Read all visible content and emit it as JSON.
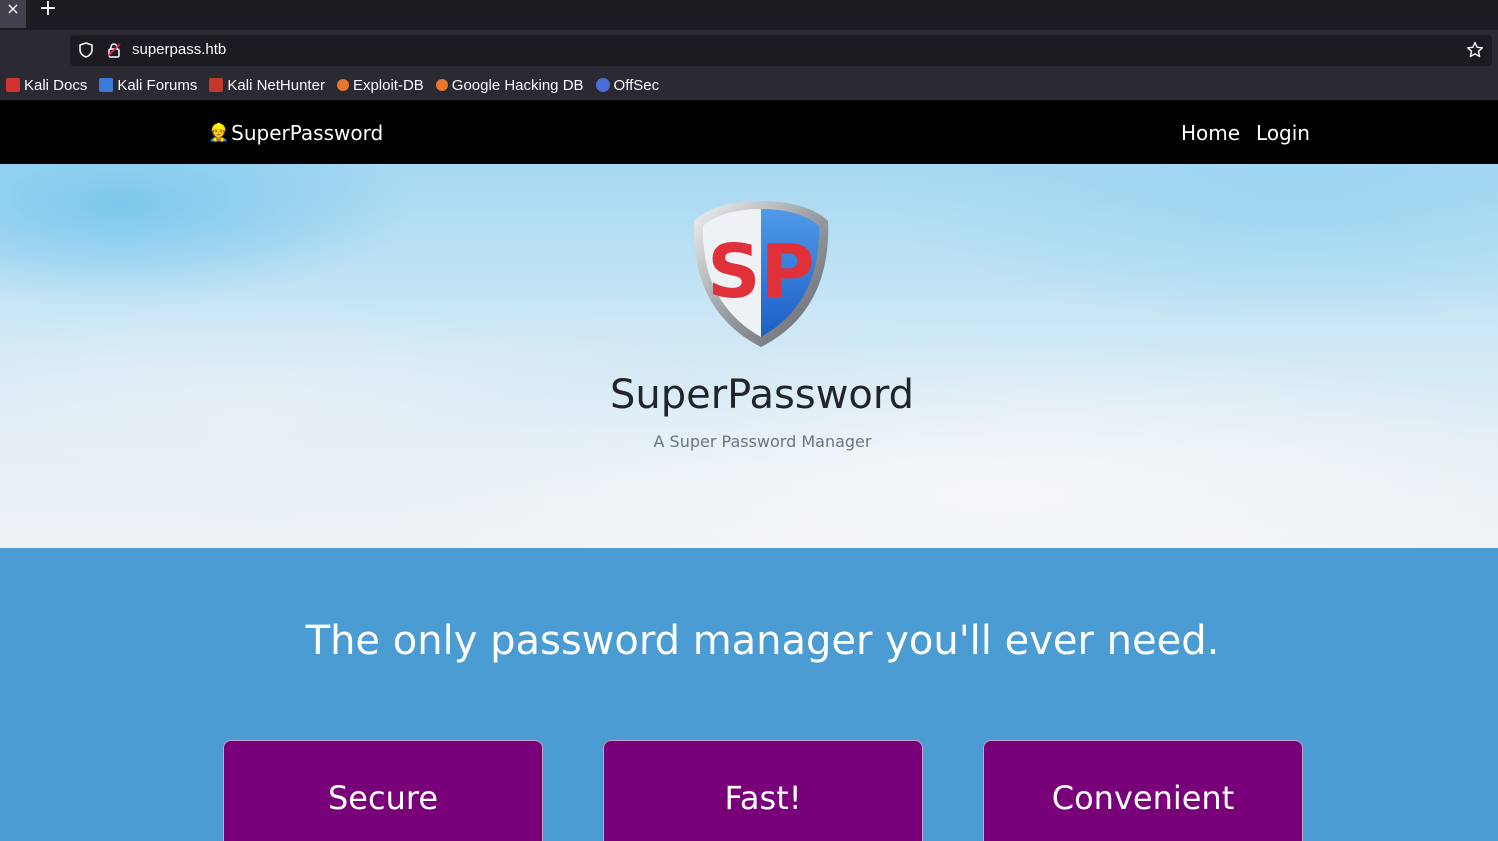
{
  "browser": {
    "tab_close_glyph": "×",
    "new_tab_glyph": "+",
    "url": "superpass.htb",
    "bookmarks": [
      {
        "label": "Kali Docs",
        "color": "#d0342c"
      },
      {
        "label": "Kali Forums",
        "color": "#3a7bd5"
      },
      {
        "label": "Kali NetHunter",
        "color": "#c0392b"
      },
      {
        "label": "Exploit-DB",
        "color": "#e8772e"
      },
      {
        "label": "Google Hacking DB",
        "color": "#e8772e"
      },
      {
        "label": "OffSec",
        "color": "#4a6fd8"
      }
    ]
  },
  "site": {
    "brand": "SuperPassword",
    "brand_icon": "👷",
    "nav": {
      "home": "Home",
      "login": "Login"
    },
    "hero": {
      "logo_text": "SP",
      "title": "SuperPassword",
      "subtitle": "A Super Password Manager"
    },
    "features": {
      "tagline": "The only password manager you'll ever need.",
      "cards": [
        "Secure",
        "Fast!",
        "Convenient"
      ]
    }
  },
  "colors": {
    "nav_bg": "#000000",
    "features_bg": "#4b9cd3",
    "card_bg": "#780078",
    "logo_red": "#e0303a",
    "logo_blue": "#2a6fd8"
  }
}
